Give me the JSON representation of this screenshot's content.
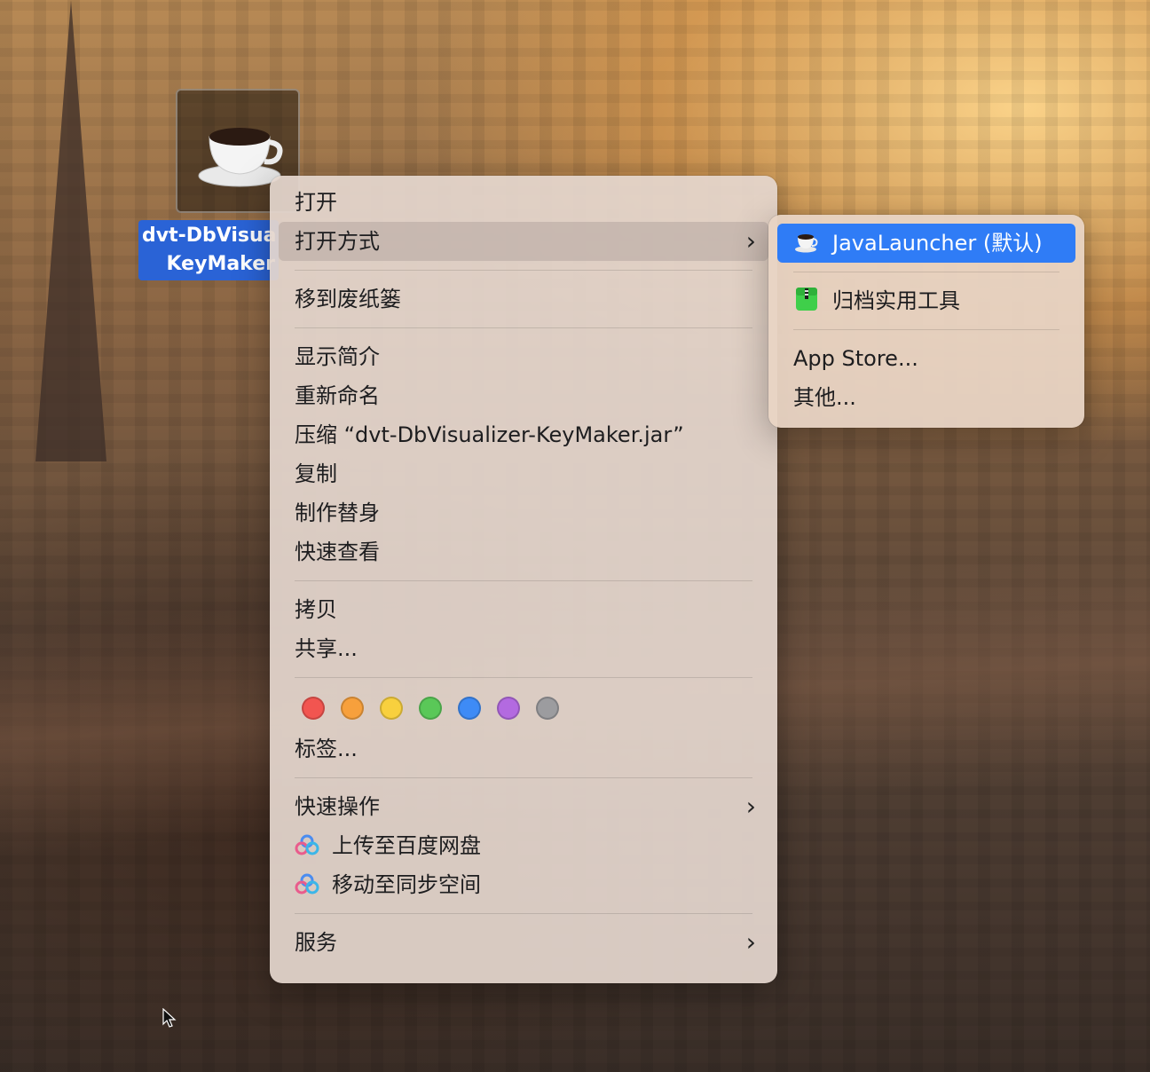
{
  "desktop": {
    "file_icon": {
      "label_line1": "dvt-DbVisua",
      "label_line2": "KeyMaker"
    }
  },
  "context_menu": {
    "open": "打开",
    "open_with": "打开方式",
    "move_to_trash": "移到废纸篓",
    "get_info": "显示简介",
    "rename": "重新命名",
    "compress": "压缩 “dvt-DbVisualizer-KeyMaker.jar”",
    "duplicate": "复制",
    "make_alias": "制作替身",
    "quick_look": "快速查看",
    "copy": "拷贝",
    "share": "共享...",
    "tags": "标签...",
    "quick_actions": "快速操作",
    "upload_baidu": "上传至百度网盘",
    "move_sync": "移动至同步空间",
    "services": "服务",
    "tag_colors": [
      "#f25550",
      "#f7a03c",
      "#f8d03e",
      "#5ac858",
      "#3e8bf6",
      "#b36ae0",
      "#9c9c9f"
    ]
  },
  "open_with_submenu": {
    "default_app": "JavaLauncher (默认)",
    "archive_utility": "归档实用工具",
    "app_store": "App Store...",
    "other": "其他..."
  },
  "colors": {
    "selection_blue": "#2f7cf6",
    "label_blue": "#2a63d6"
  }
}
